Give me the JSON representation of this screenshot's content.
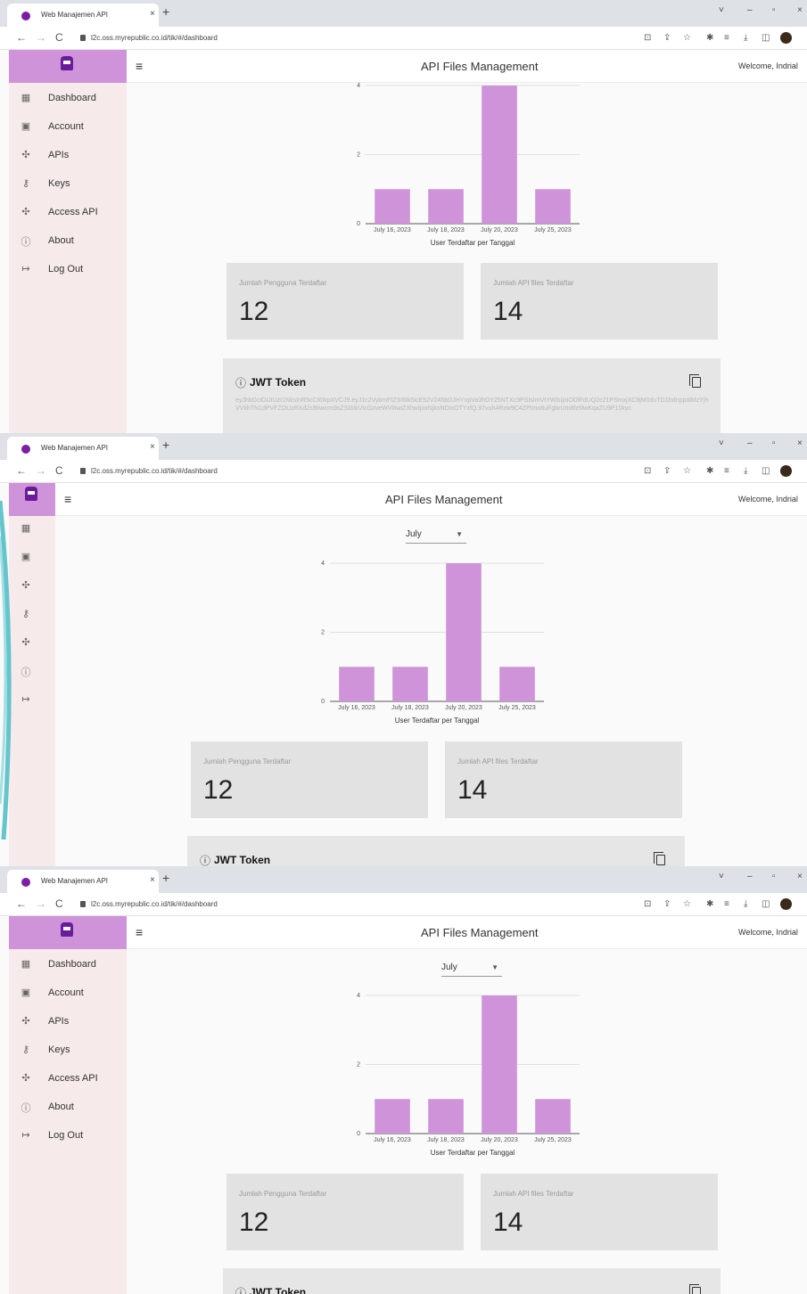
{
  "browser": {
    "tab_title": "Web Manajemen API",
    "tab_close": "×",
    "new_tab": "+",
    "url": "l2c.oss.myrepublic.co.id/tik/#/dashboard",
    "controls": [
      "˅",
      "–",
      "▫",
      "×"
    ]
  },
  "app": {
    "title": "API Files Management",
    "welcome": "Welcome, Indrial",
    "menu_icon": "≡",
    "accent": "#ce93d8",
    "sidebar_bg": "#f7eaea"
  },
  "sidebar": {
    "items": [
      {
        "label": "Dashboard",
        "icon": "dashboard-icon"
      },
      {
        "label": "Account",
        "icon": "account-icon"
      },
      {
        "label": "APIs",
        "icon": "apis-icon"
      },
      {
        "label": "Keys",
        "icon": "key-icon"
      },
      {
        "label": "Access API",
        "icon": "access-api-icon"
      },
      {
        "label": "About",
        "icon": "info-icon"
      },
      {
        "label": "Log Out",
        "icon": "logout-icon"
      }
    ]
  },
  "month_select": {
    "value": "July"
  },
  "chart_data": {
    "type": "bar",
    "categories": [
      "July 16, 2023",
      "July 18, 2023",
      "July 20, 2023",
      "July 25, 2023"
    ],
    "values": [
      1,
      1,
      4,
      1
    ],
    "xlabel": "User Terdaftar per Tanggal",
    "ylabel": "",
    "ylim": [
      0,
      4
    ],
    "yticks": [
      0,
      2,
      4
    ],
    "color": "#ce93d8",
    "grid": true
  },
  "stats": {
    "users_label": "Jumlah Pengguna Terdaftar",
    "users_value": "12",
    "apis_label": "Jumlah API files Terdaftar",
    "apis_value": "14"
  },
  "jwt": {
    "title": "JWT Token",
    "token": "eyJhbGciOiJIUzI1NiIsInR5cCI6IkpXVCJ9.eyJ1c2VybmFtZSI6Ik5icE52V245bDJHYnpVa3hDY25NTXc9PSIsImVtYWlsIjoiODlFdUQ2c21PSmxjXC9jM0duTG1hdnppalMzYjhVVkhTN1dPVFZOUzRXd2s9Iiwicm9sZSI6IkVtcGxveWVlIiwiZXhwIjoxNjkxNDIxOTYzfQ.97vuh4Rzw9C4ZPtmo8uFgbrUm8fz6lwKqaZU9P10kyc"
  }
}
